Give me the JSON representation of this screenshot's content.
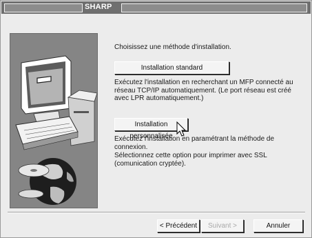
{
  "window": {
    "title": "SHARP"
  },
  "main": {
    "prompt": "Choisissez une méthode d'installation.",
    "standard_button_label": "Installation standard",
    "standard_description": "Exécutez l'installation en recherchant un MFP connecté au réseau TCP/IP automatiquement. (Le port réseau est créé avec LPR automatiquement.)",
    "custom_button_label": "Installation personnalisée",
    "custom_description_1": "Exécutez l'installation en paramétrant la méthode de connexion.",
    "custom_description_2": "Sélectionnez cette option pour imprimer avec SSL (comunication cryptée)."
  },
  "footer": {
    "back_label": "< Précédent",
    "next_label": "Suivant >",
    "cancel_label": "Annuler"
  },
  "icons": [
    "computer-illustration",
    "printer-illustration",
    "globe-icon",
    "mouse-pointer-icon"
  ],
  "colors": {
    "titlebar": "#6f6f6f",
    "window_bg": "#ececec",
    "art_panel": "#858585"
  }
}
